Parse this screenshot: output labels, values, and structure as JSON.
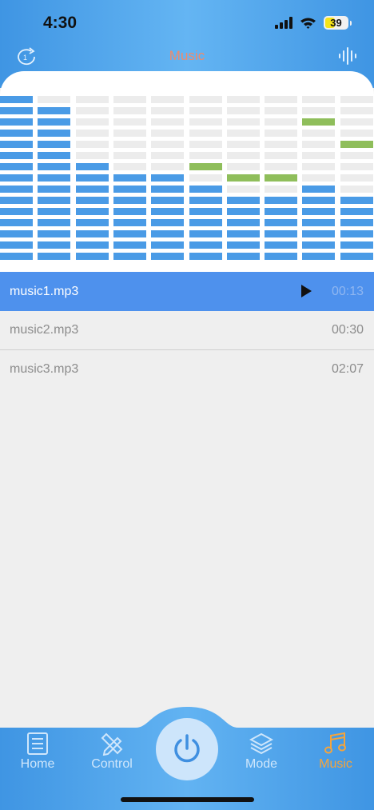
{
  "status": {
    "time": "4:30",
    "battery": "39"
  },
  "nav": {
    "title": "Music"
  },
  "equalizer": {
    "bar_levels": [
      15,
      14,
      9,
      8,
      8,
      7,
      6,
      6,
      7,
      6
    ],
    "peak_levels": [
      null,
      null,
      null,
      null,
      null,
      8,
      7,
      7,
      12,
      10
    ],
    "segments": 15,
    "bar_color": "#4a9be6",
    "empty_color": "#ececec",
    "peak_color": "#8fbe5b"
  },
  "tracks": [
    {
      "name": "music1.mp3",
      "duration": "00:13"
    },
    {
      "name": "music2.mp3",
      "duration": "00:30"
    },
    {
      "name": "music3.mp3",
      "duration": "02:07"
    }
  ],
  "tabbar": {
    "home": "Home",
    "control": "Control",
    "mode": "Mode",
    "music": "Music",
    "active_tab": "music",
    "background": "#3f95e3"
  }
}
